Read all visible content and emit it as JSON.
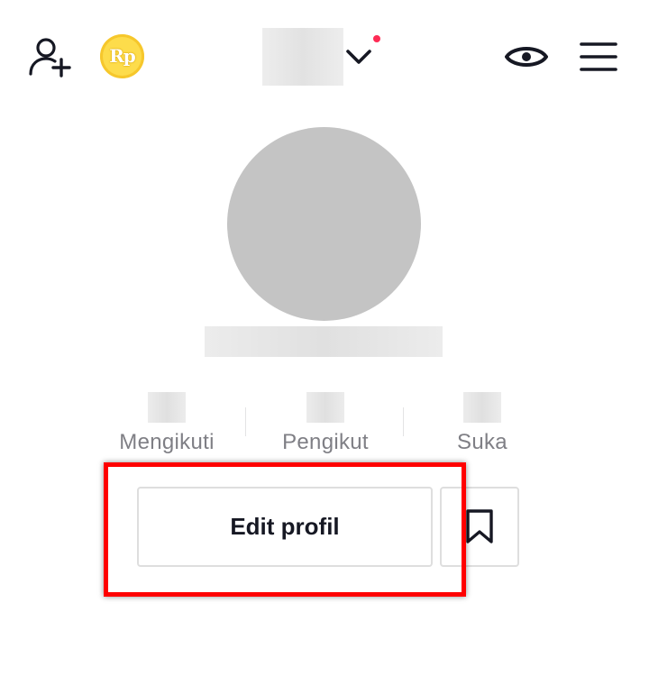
{
  "header": {
    "coin_label": "Rp",
    "icons": {
      "add_friend": "add-friend-icon",
      "coin": "coin-icon",
      "switch_account": "chevron-down-icon",
      "notification": "notification-dot",
      "profile_views": "eye-icon",
      "menu": "hamburger-menu-icon"
    },
    "accent_color": "#fe2c55"
  },
  "profile": {
    "avatar": "avatar-placeholder"
  },
  "stats": {
    "following_label": "Mengikuti",
    "followers_label": "Pengikut",
    "likes_label": "Suka"
  },
  "actions": {
    "edit_profile_label": "Edit profil",
    "bookmark_icon": "bookmark-icon",
    "highlight_color": "#ff0000"
  }
}
